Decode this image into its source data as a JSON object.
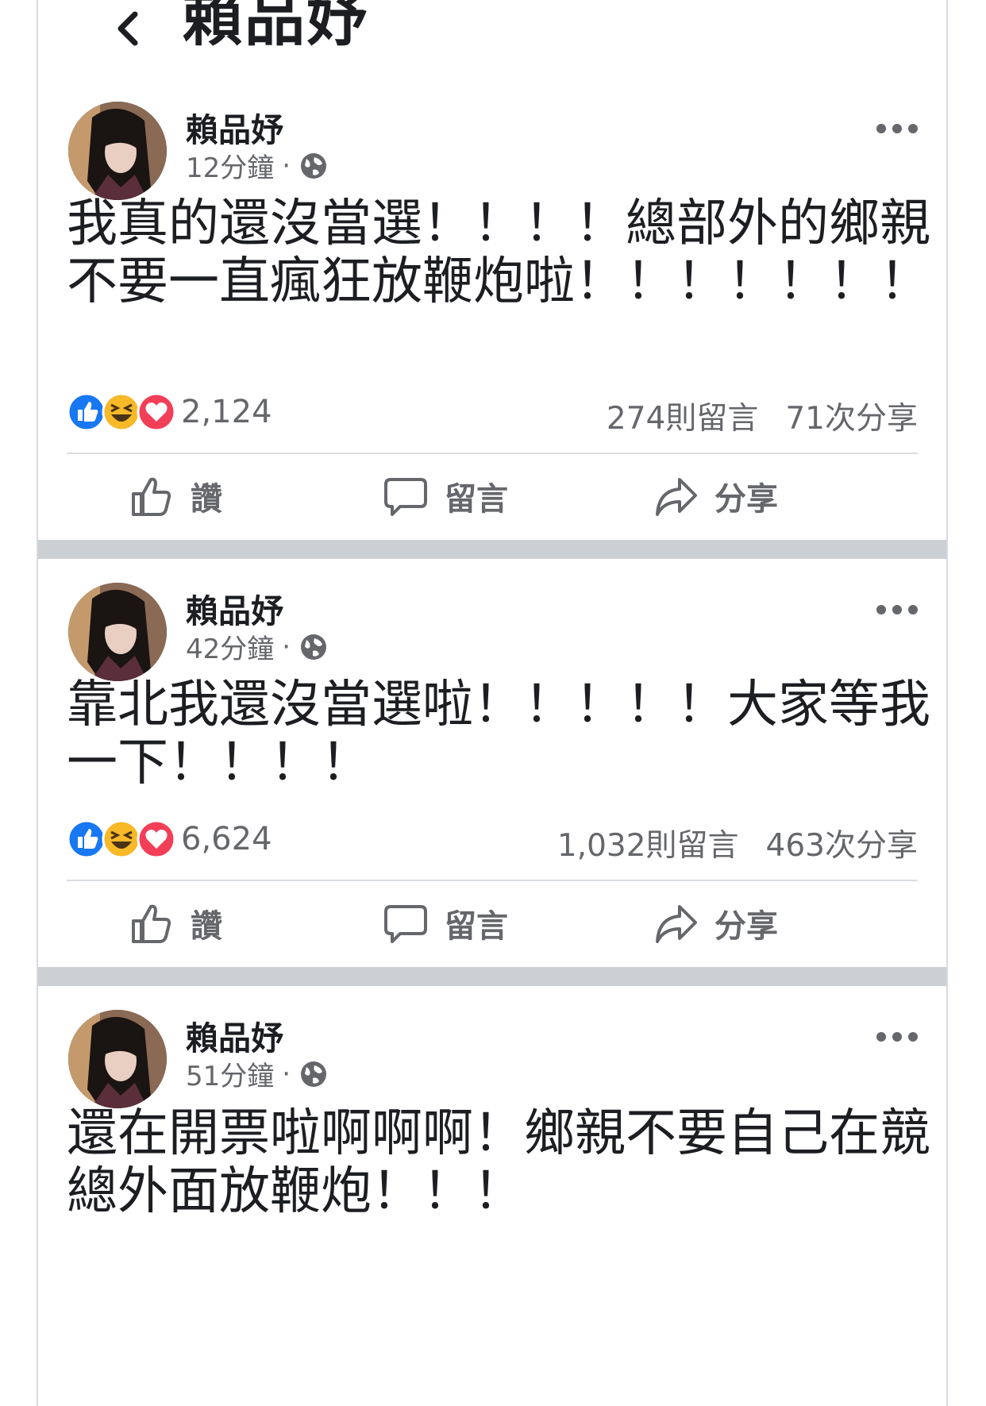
{
  "header": {
    "title": "賴品妤"
  },
  "actions": {
    "like": "讚",
    "comment": "留言",
    "share": "分享"
  },
  "posts": [
    {
      "author": "賴品妤",
      "time": "12分鐘",
      "dot": "·",
      "text": "我真的還沒當選！！！！總部外的鄉親不要一直瘋狂放鞭炮啦！！！！！！！",
      "reactions": "2,124",
      "comments": "274則留言",
      "shares": "71次分享"
    },
    {
      "author": "賴品妤",
      "time": "42分鐘",
      "dot": "·",
      "text": "靠北我還沒當選啦！！！！！大家等我一下！！！！",
      "reactions": "6,624",
      "comments": "1,032則留言",
      "shares": "463次分享"
    },
    {
      "author": "賴品妤",
      "time": "51分鐘",
      "dot": "·",
      "text": "還在開票啦啊啊啊！鄉親不要自己在競總外面放鞭炮！！！",
      "reactions": "",
      "comments": "",
      "shares": ""
    }
  ],
  "colors": {
    "like_blue": "#1877f2",
    "love_red": "#f33e58",
    "haha_yellow": "#f7b928",
    "separator": "#cccfd4"
  }
}
